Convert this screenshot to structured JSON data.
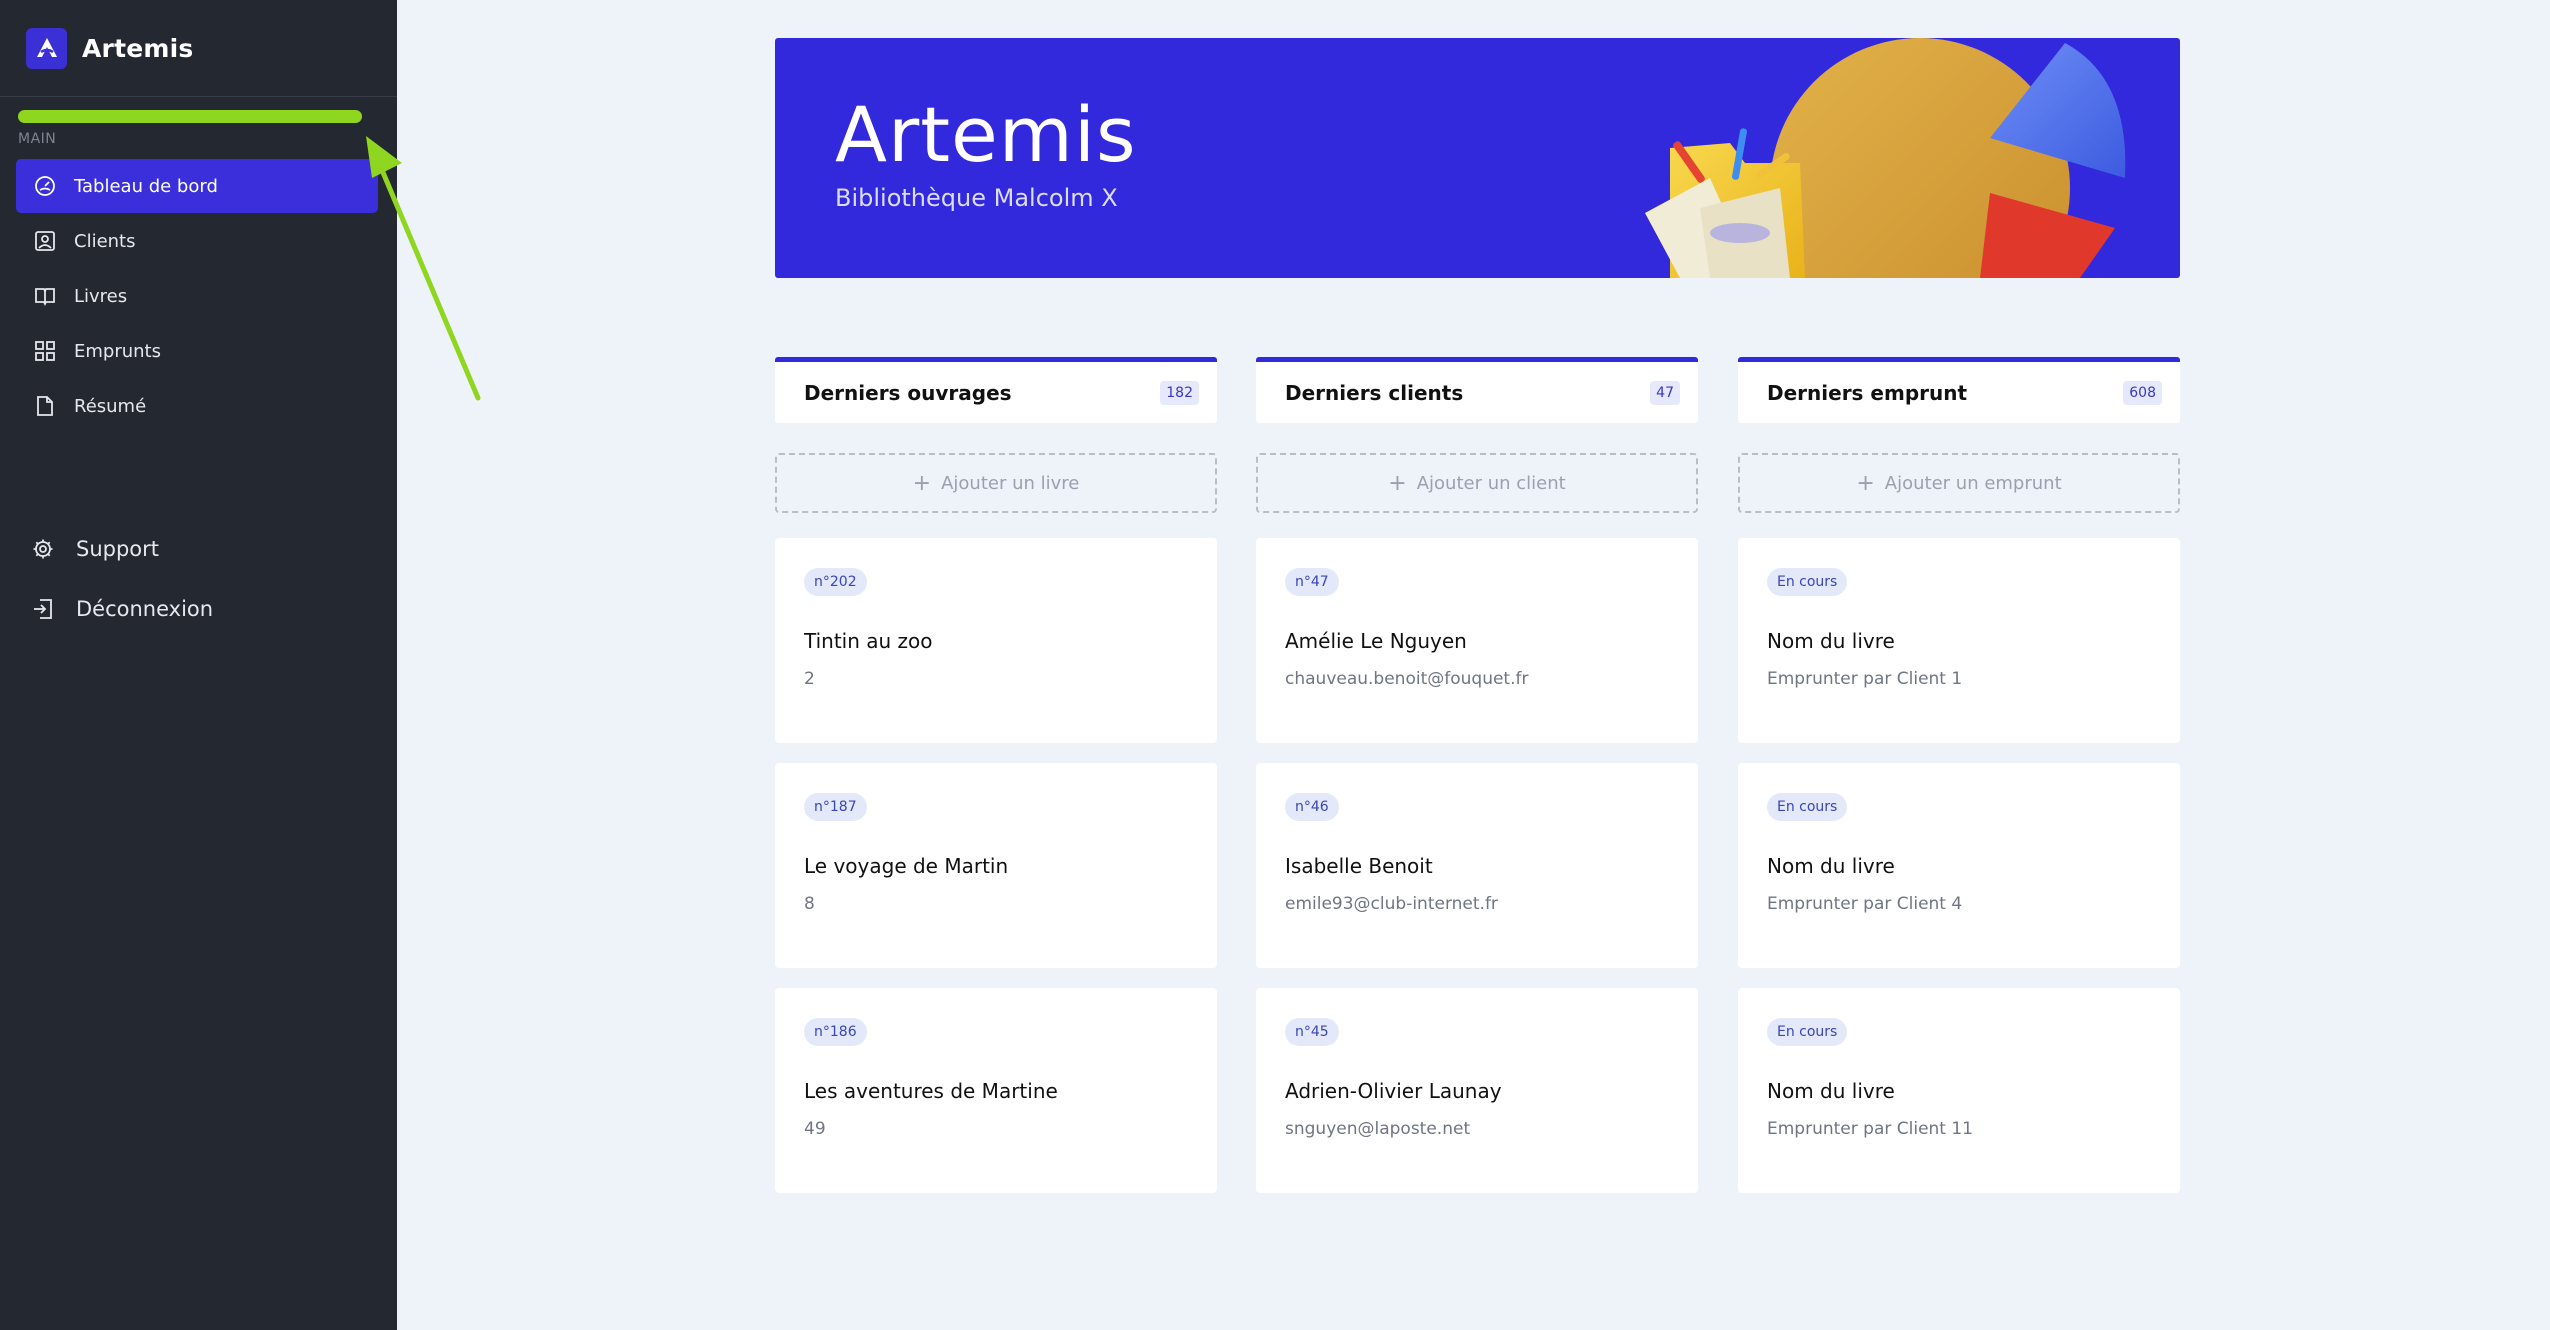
{
  "app": {
    "name": "Artemis"
  },
  "sidebar": {
    "progress": 1.0,
    "section_label": "MAIN",
    "items": [
      {
        "label": "Tableau de bord",
        "icon": "dashboard-icon",
        "active": true
      },
      {
        "label": "Clients",
        "icon": "user-badge-icon"
      },
      {
        "label": "Livres",
        "icon": "book-icon"
      },
      {
        "label": "Emprunts",
        "icon": "grid-icon"
      },
      {
        "label": "Résumé",
        "icon": "file-icon"
      }
    ],
    "bottom_items": [
      {
        "label": "Support",
        "icon": "gear-icon"
      },
      {
        "label": "Déconnexion",
        "icon": "logout-icon"
      }
    ]
  },
  "banner": {
    "title": "Artemis",
    "subtitle": "Bibliothèque Malcolm X"
  },
  "columns": [
    {
      "title": "Derniers ouvrages",
      "count": "182",
      "add_label": "Ajouter un livre",
      "cards": [
        {
          "tag": "n°202",
          "title": "Tintin au zoo",
          "sub": "2"
        },
        {
          "tag": "n°187",
          "title": "Le voyage de Martin",
          "sub": "8"
        },
        {
          "tag": "n°186",
          "title": "Les aventures de Martine",
          "sub": "49"
        }
      ]
    },
    {
      "title": "Derniers clients",
      "count": "47",
      "add_label": "Ajouter un client",
      "cards": [
        {
          "tag": "n°47",
          "title": "Amélie Le Nguyen",
          "sub": "chauveau.benoit@fouquet.fr"
        },
        {
          "tag": "n°46",
          "title": "Isabelle Benoit",
          "sub": "emile93@club-internet.fr"
        },
        {
          "tag": "n°45",
          "title": "Adrien-Olivier Launay",
          "sub": "snguyen@laposte.net"
        }
      ]
    },
    {
      "title": "Derniers emprunt",
      "count": "608",
      "add_label": "Ajouter un emprunt",
      "cards": [
        {
          "tag": "En cours",
          "title": "Nom du livre",
          "sub": "Emprunter par Client 1"
        },
        {
          "tag": "En cours",
          "title": "Nom du livre",
          "sub": "Emprunter par Client 4"
        },
        {
          "tag": "En cours",
          "title": "Nom du livre",
          "sub": "Emprunter par Client 11"
        }
      ]
    }
  ],
  "colors": {
    "accent": "#3228dc",
    "sidebar_bg": "#242830",
    "page_bg": "#eef2f9",
    "annotation": "#8ed61f"
  }
}
